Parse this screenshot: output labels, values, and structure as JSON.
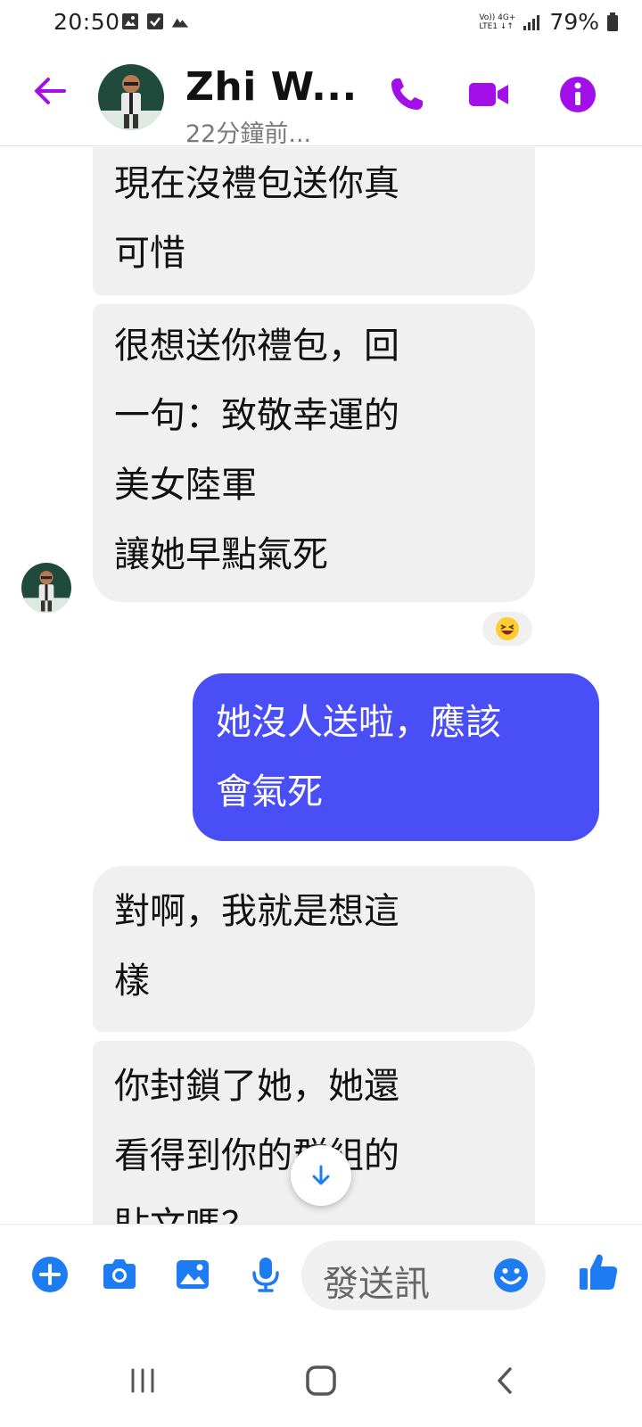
{
  "status_bar": {
    "time": "20:50",
    "net_top": "Vo))  4G+",
    "net_bottom": "LTE1  ↓↑",
    "battery": "79%"
  },
  "header": {
    "contact_name": "Zhi W...",
    "contact_status": "22分鐘前...",
    "accent_color": "#a30fe8"
  },
  "messages": [
    {
      "direction": "incoming",
      "text": "現在沒禮包送你真\n可惜"
    },
    {
      "direction": "incoming",
      "text": "很想送你禮包，回\n一句：致敬幸運的\n美女陸軍\n讓她早點氣死",
      "reaction": "😆"
    },
    {
      "direction": "outgoing",
      "text": "她沒人送啦，應該\n會氣死"
    },
    {
      "direction": "incoming",
      "text": "對啊，我就是想這\n樣"
    },
    {
      "direction": "incoming",
      "text": "你封鎖了她，她還\n看得到你的群組的\n貼文嗎？"
    }
  ],
  "composer": {
    "placeholder": "發送訊",
    "icon_color": "#1d7cf2"
  },
  "colors": {
    "outgoing_bubble": "#4a4ef6",
    "incoming_bubble": "#f0f0f0"
  }
}
